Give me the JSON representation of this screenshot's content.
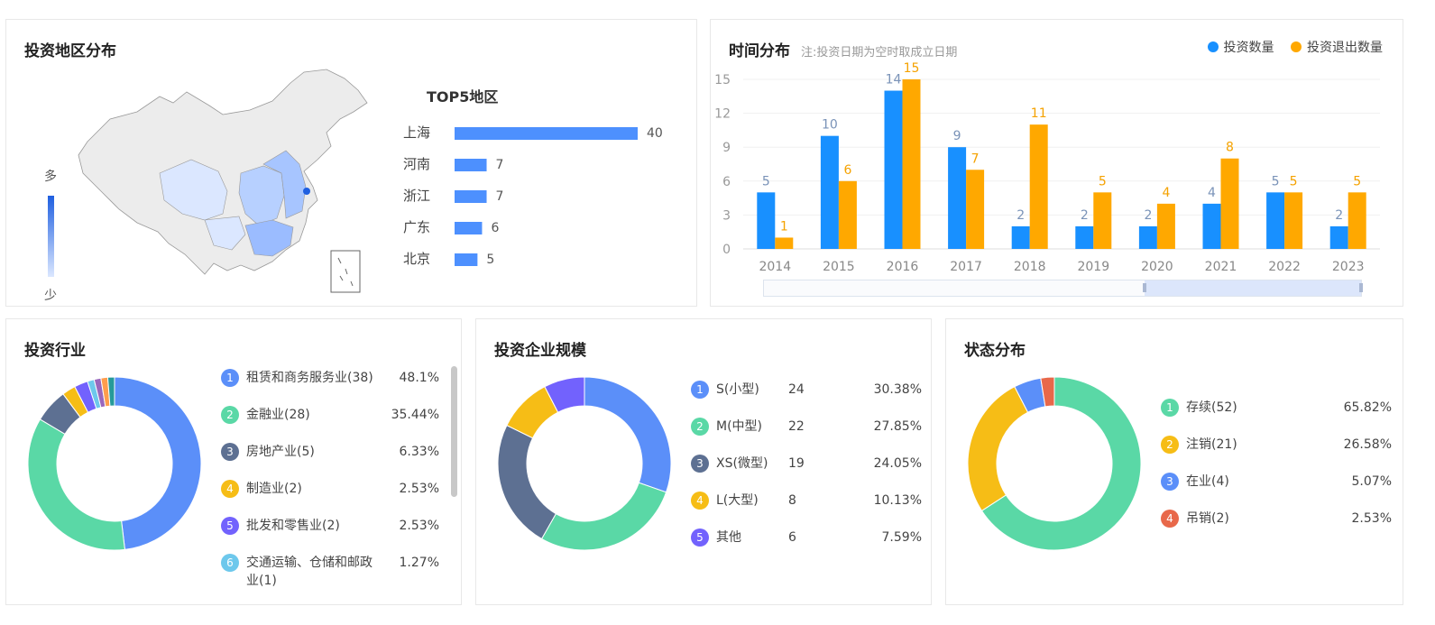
{
  "region": {
    "title": "投资地区分布",
    "scale_high": "多",
    "scale_low": "少",
    "top5_title": "TOP5地区",
    "top5": [
      {
        "name": "上海",
        "value": 40
      },
      {
        "name": "河南",
        "value": 7
      },
      {
        "name": "浙江",
        "value": 7
      },
      {
        "name": "广东",
        "value": 6
      },
      {
        "name": "北京",
        "value": 5
      }
    ]
  },
  "time": {
    "title": "时间分布",
    "subtitle": "注:投资日期为空时取成立日期",
    "legend": [
      "投资数量",
      "投资退出数量"
    ]
  },
  "industry": {
    "title": "投资行业",
    "items": [
      {
        "idx": "1",
        "label": "租赁和商务服务业(38)",
        "pct": "48.1%",
        "color": "#5b8ff9"
      },
      {
        "idx": "2",
        "label": "金融业(28)",
        "pct": "35.44%",
        "color": "#5ad8a6"
      },
      {
        "idx": "3",
        "label": "房地产业(5)",
        "pct": "6.33%",
        "color": "#5d7092"
      },
      {
        "idx": "4",
        "label": "制造业(2)",
        "pct": "2.53%",
        "color": "#f6bd16"
      },
      {
        "idx": "5",
        "label": "批发和零售业(2)",
        "pct": "2.53%",
        "color": "#7262fd"
      },
      {
        "idx": "6",
        "label": "交通运输、仓储和邮政业(1)",
        "pct": "1.27%",
        "color": "#6dc8ec"
      }
    ]
  },
  "scale": {
    "title": "投资企业规模",
    "items": [
      {
        "idx": "1",
        "label": "S(小型)",
        "count": "24",
        "pct": "30.38%",
        "color": "#5b8ff9"
      },
      {
        "idx": "2",
        "label": "M(中型)",
        "count": "22",
        "pct": "27.85%",
        "color": "#5ad8a6"
      },
      {
        "idx": "3",
        "label": "XS(微型)",
        "count": "19",
        "pct": "24.05%",
        "color": "#5d7092"
      },
      {
        "idx": "4",
        "label": "L(大型)",
        "count": "8",
        "pct": "10.13%",
        "color": "#f6bd16"
      },
      {
        "idx": "5",
        "label": "其他",
        "count": "6",
        "pct": "7.59%",
        "color": "#7262fd"
      }
    ]
  },
  "status": {
    "title": "状态分布",
    "items": [
      {
        "idx": "1",
        "label": "存续(52)",
        "pct": "65.82%",
        "color": "#5ad8a6"
      },
      {
        "idx": "2",
        "label": "注销(21)",
        "pct": "26.58%",
        "color": "#f6bd16"
      },
      {
        "idx": "3",
        "label": "在业(4)",
        "pct": "5.07%",
        "color": "#5b8ff9"
      },
      {
        "idx": "4",
        "label": "吊销(2)",
        "pct": "2.53%",
        "color": "#e8684a"
      }
    ]
  },
  "chart_data": [
    {
      "type": "bar",
      "title": "TOP5地区",
      "categories": [
        "上海",
        "河南",
        "浙江",
        "广东",
        "北京"
      ],
      "values": [
        40,
        7,
        7,
        6,
        5
      ]
    },
    {
      "type": "bar",
      "title": "时间分布",
      "categories": [
        "2014",
        "2015",
        "2016",
        "2017",
        "2018",
        "2019",
        "2020",
        "2021",
        "2022",
        "2023"
      ],
      "series": [
        {
          "name": "投资数量",
          "values": [
            5,
            10,
            14,
            9,
            2,
            2,
            2,
            4,
            5,
            2
          ],
          "color": "#1890ff"
        },
        {
          "name": "投资退出数量",
          "values": [
            1,
            6,
            15,
            7,
            11,
            5,
            4,
            8,
            5,
            5
          ],
          "color": "#ffa800"
        }
      ],
      "yticks": [
        0,
        3,
        6,
        9,
        12,
        15
      ],
      "ylim": [
        0,
        16
      ],
      "legend_position": "top-right"
    },
    {
      "type": "pie",
      "title": "投资行业",
      "values": [
        48.1,
        35.44,
        6.33,
        2.53,
        2.53,
        1.27,
        1.27,
        1.27,
        1.26
      ],
      "colors": [
        "#5b8ff9",
        "#5ad8a6",
        "#5d7092",
        "#f6bd16",
        "#7262fd",
        "#6dc8ec",
        "#9967bd",
        "#ff9d4d",
        "#269a99"
      ]
    },
    {
      "type": "pie",
      "title": "投资企业规模",
      "values": [
        30.38,
        27.85,
        24.05,
        10.13,
        7.59
      ],
      "colors": [
        "#5b8ff9",
        "#5ad8a6",
        "#5d7092",
        "#f6bd16",
        "#7262fd"
      ]
    },
    {
      "type": "pie",
      "title": "状态分布",
      "values": [
        65.82,
        26.58,
        5.07,
        2.53
      ],
      "colors": [
        "#5ad8a6",
        "#f6bd16",
        "#5b8ff9",
        "#e8684a"
      ]
    }
  ]
}
